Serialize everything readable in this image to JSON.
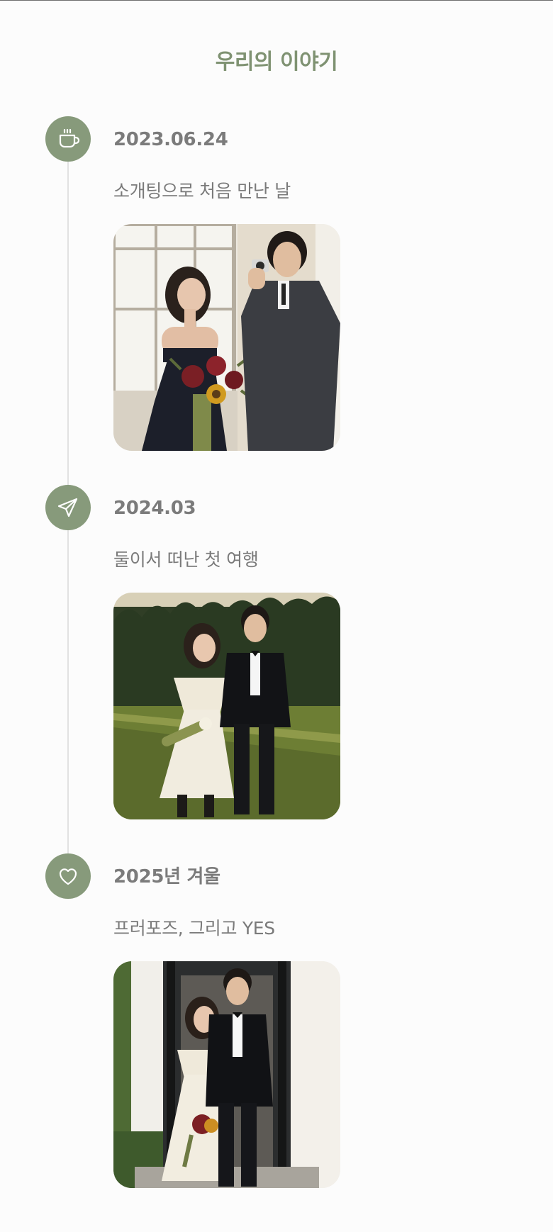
{
  "page": {
    "title": "우리의 이야기"
  },
  "timeline": [
    {
      "icon": "coffee-cup-icon",
      "date": "2023.06.24",
      "description": "소개팅으로 처음 만난 날",
      "photo": "indoor-photo-couple-with-camera-and-bouquet"
    },
    {
      "icon": "paper-plane-icon",
      "date": "2024.03",
      "description": "둘이서 떠난 첫 여행",
      "photo": "garden-photo-couple-walking-hand-in-hand"
    },
    {
      "icon": "heart-icon",
      "date": "2025년 겨울",
      "description": "프러포즈, 그리고 YES",
      "photo": "doorway-photo-couple-smiling-together"
    }
  ],
  "colors": {
    "accent": "#879a7b",
    "title": "#7f9272",
    "text": "#7b7b7b",
    "line": "#e2e2e2",
    "background": "#fcfcfc"
  }
}
